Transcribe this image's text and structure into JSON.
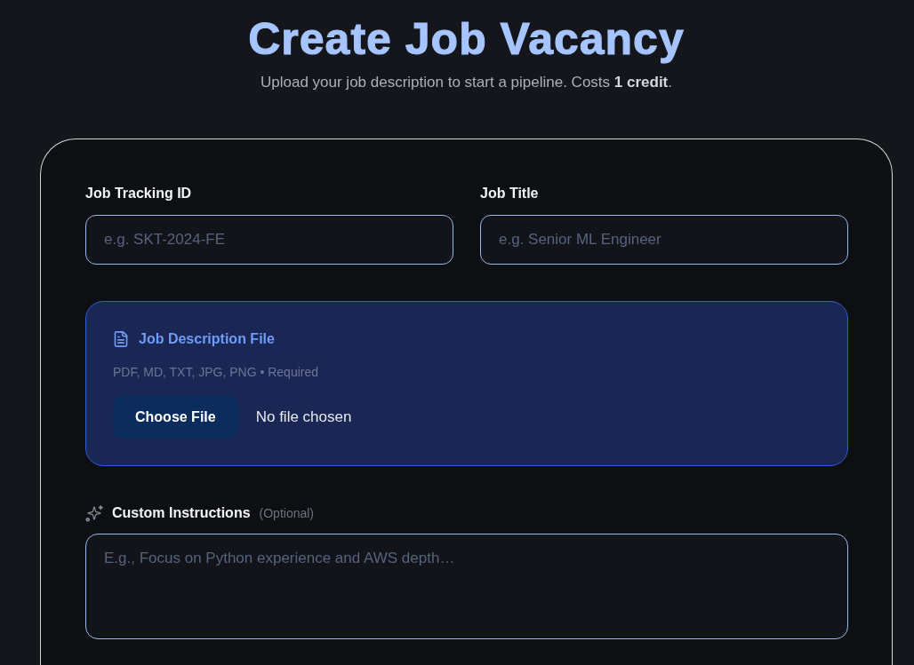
{
  "header": {
    "title": "Create Job Vacancy",
    "subtitle": "Upload your job description to start a pipeline. Costs **1 credit**."
  },
  "form": {
    "fields": [
      {
        "label": "Job Tracking ID",
        "placeholder": "e.g. SKT-2024-FE"
      },
      {
        "label": "Job Title",
        "placeholder": "e.g. Senior ML Engineer"
      }
    ],
    "upload": {
      "title": "Job Description File",
      "hint": "PDF, MD, TXT, JPG, PNG • Required",
      "button": "Choose File",
      "status": "No file chosen"
    },
    "instructions": {
      "label": "Custom Instructions",
      "note": "(Optional)",
      "placeholder": "E.g., Focus on Python experience and AWS depth…"
    }
  }
}
